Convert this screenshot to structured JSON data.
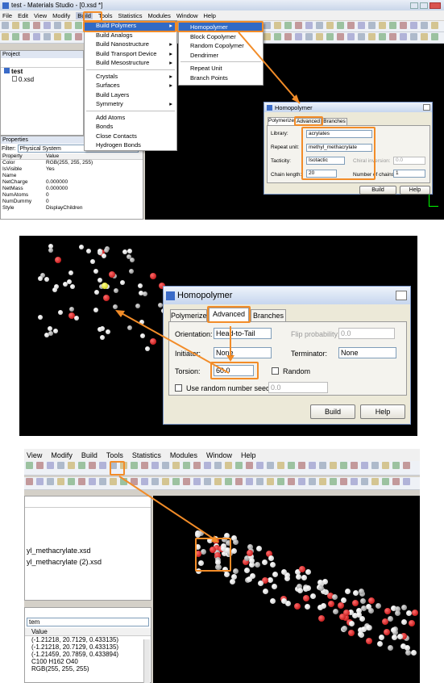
{
  "panel1": {
    "title": "test - Materials Studio - [0.xsd *]",
    "menu": [
      "File",
      "Edit",
      "View",
      "Modify",
      "Build",
      "Tools",
      "Statistics",
      "Modules",
      "Window",
      "Help"
    ],
    "build_menu": {
      "items": [
        {
          "label": "Build Polymers",
          "arrow": "▸"
        },
        {
          "label": "Build Analogs"
        },
        {
          "label": "Build Nanostructure",
          "arrow": "▸"
        },
        {
          "label": "Build Transport Device",
          "arrow": "▸"
        },
        {
          "label": "Build Mesostructure",
          "arrow": "▸"
        },
        {
          "sep": true
        },
        {
          "label": "Crystals",
          "arrow": "▸"
        },
        {
          "label": "Surfaces",
          "arrow": "▸"
        },
        {
          "label": "Build Layers"
        },
        {
          "label": "Symmetry",
          "arrow": "▸"
        },
        {
          "sep": true
        },
        {
          "label": "Add Atoms"
        },
        {
          "label": "Bonds"
        },
        {
          "label": "Close Contacts"
        },
        {
          "label": "Hydrogen Bonds"
        }
      ]
    },
    "polymer_submenu": {
      "items": [
        "Homopolymer",
        "Block Copolymer",
        "Random Copolymer",
        "Dendrimer",
        "Repeat Unit",
        "Branch Points"
      ]
    },
    "project": {
      "header": "Project",
      "root": "test",
      "file": "0.xsd"
    },
    "properties": {
      "header": "Properties",
      "filter_label": "Filter:",
      "filter_value": "Physical System",
      "col_property": "Property",
      "col_value": "Value",
      "rows": [
        [
          "Color",
          "RGB(255, 255, 255)"
        ],
        [
          "IsVisible",
          "Yes"
        ],
        [
          "Name",
          ""
        ],
        [
          "NetCharge",
          "0.000000"
        ],
        [
          "NetMass",
          "0.000000"
        ],
        [
          "NumAtoms",
          "0"
        ],
        [
          "NumDummy",
          "0"
        ],
        [
          "Style",
          "DisplayChildren"
        ]
      ]
    },
    "small_dialog": {
      "title": "Homopolymer",
      "tabs": [
        "Polymerize",
        "Advanced",
        "Branches"
      ],
      "library_label": "Library:",
      "library_value": "acrylates",
      "repeat_label": "Repeat unit:",
      "repeat_value": "methyl_methacrylate",
      "tacticity_label": "Tacticity:",
      "tacticity_value": "Isotactic",
      "chiral_label": "Chiral inversion:",
      "chiral_value": "0.0",
      "chain_label": "Chain length:",
      "chain_value": "20",
      "num_label": "Number of chains:",
      "num_value": "1",
      "build": "Build",
      "help": "Help"
    }
  },
  "panel2": {
    "dialog": {
      "title": "Homopolymer",
      "tabs": [
        "Polymerize",
        "Advanced",
        "Branches"
      ],
      "orientation_label": "Orientation:",
      "orientation_value": "Head-to-Tail",
      "flip_label": "Flip probability:",
      "flip_value": "0.0",
      "initiator_label": "Initiator:",
      "initiator_value": "None",
      "terminator_label": "Terminator:",
      "terminator_value": "None",
      "torsion_label": "Torsion:",
      "torsion_value": "60.0",
      "random_label": "Random",
      "seed_label": "Use random number seed:",
      "seed_value": "0.0",
      "build": "Build",
      "help": "Help"
    }
  },
  "panel3": {
    "menu": [
      "View",
      "Modify",
      "Build",
      "Tools",
      "Statistics",
      "Modules",
      "Window",
      "Help"
    ],
    "files": [
      "yl_methacrylate.xsd",
      "yl_methacrylate (2).xsd"
    ],
    "filter_value": "tem",
    "col_value": "Value",
    "rows": [
      "(-1.21218, 20.7129, 0.433135)",
      "(-1.21218, 20.7129, 0.433135)",
      "(-1.21459, 20.7859, 0.433894)",
      "C100 H162 O40",
      "RGB(255, 255, 255)"
    ]
  },
  "colors": {
    "accent": "#f28c28",
    "selection": "#316ac5",
    "viewport": "#000000"
  }
}
